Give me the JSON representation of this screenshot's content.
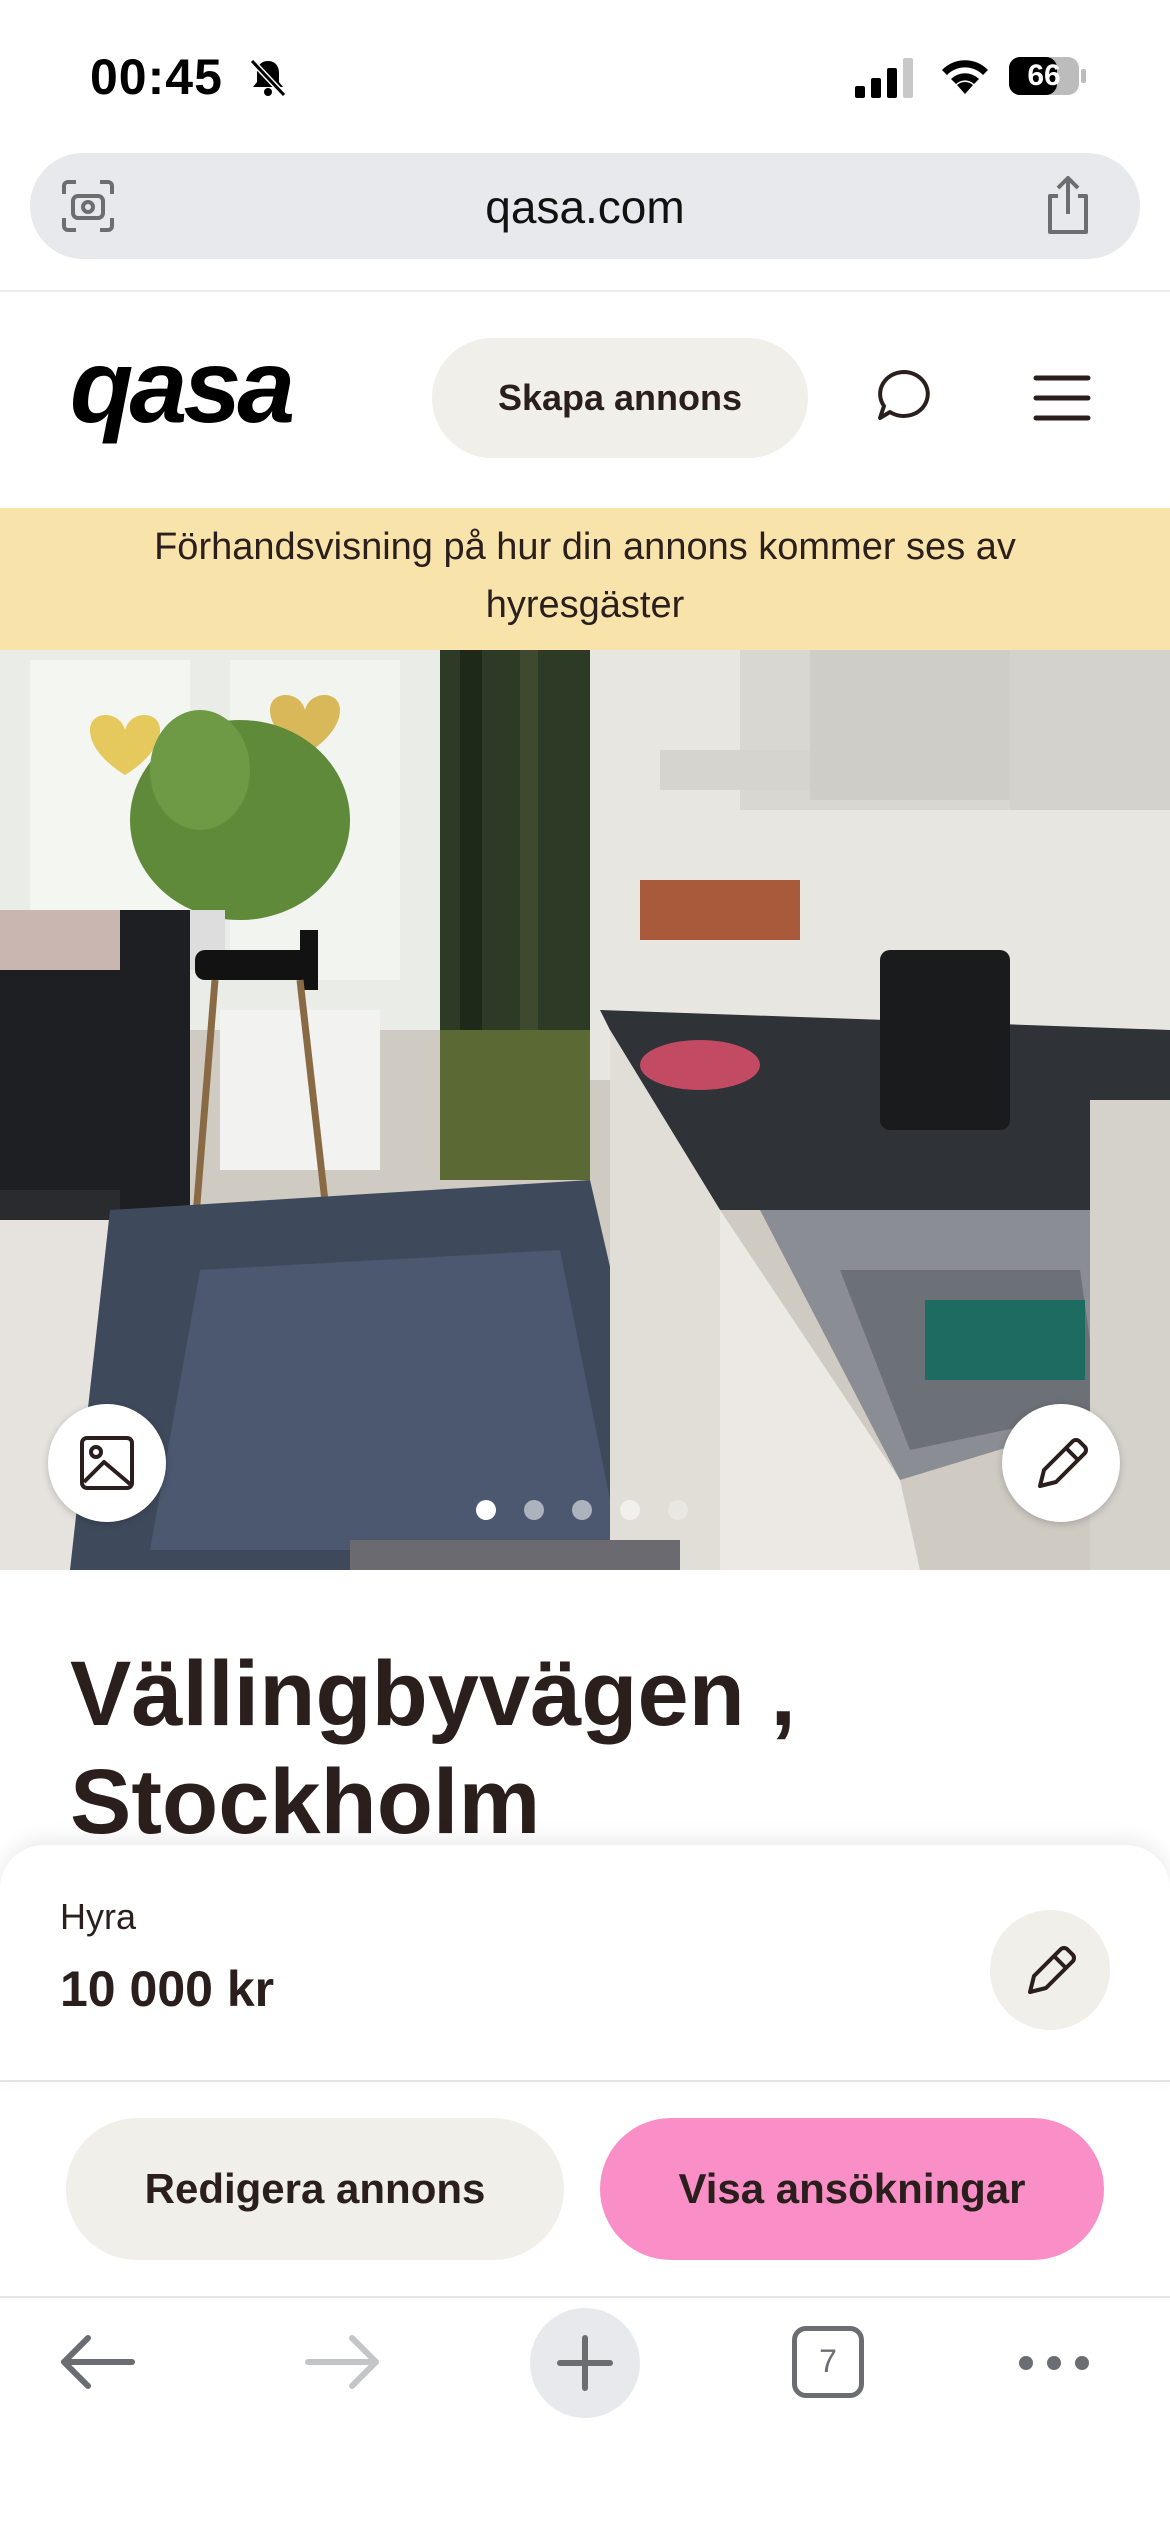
{
  "status_bar": {
    "time": "00:45",
    "battery": "66"
  },
  "browser": {
    "url": "qasa.com",
    "tab_count": "7"
  },
  "header": {
    "logo_text": "qasa",
    "create_ad_label": "Skapa annons"
  },
  "banner": {
    "text": "Förhandsvisning på hur din annons kommer ses av hyresgäster"
  },
  "listing": {
    "title": "Vällingbyvägen , Stockholm",
    "photo_count": 5,
    "current_photo": 1,
    "rent_label": "Hyra",
    "rent_value": "10 000 kr"
  },
  "actions": {
    "edit_ad_label": "Redigera annons",
    "show_applications_label": "Visa ansökningar"
  },
  "icons": {
    "status": [
      "bell-slash-icon",
      "signal-icon",
      "wifi-icon",
      "battery-icon"
    ],
    "browser": [
      "camera-search-icon",
      "share-icon",
      "back-arrow-icon",
      "forward-arrow-icon",
      "plus-icon",
      "tabs-icon",
      "more-icon"
    ],
    "page": [
      "chat-bubble-icon",
      "hamburger-menu-icon",
      "image-icon",
      "pencil-icon"
    ]
  },
  "colors": {
    "banner": "#f8e4ab",
    "primary_button": "#f98fc6",
    "secondary_button": "#f0efea",
    "text": "#2a1f1c"
  }
}
